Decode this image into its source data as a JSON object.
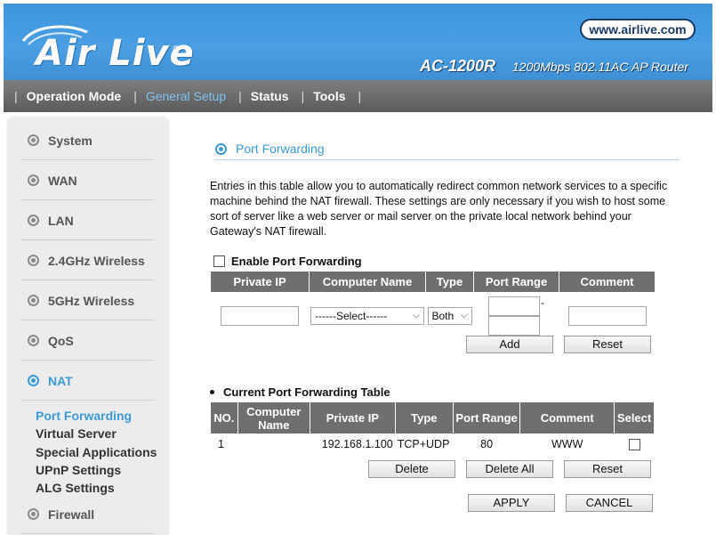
{
  "header": {
    "logo_text": "Air Live",
    "logo_reg": "®",
    "site_url": "www.airlive.com",
    "model": "AC-1200R",
    "model_desc": "1200Mbps 802.11AC AP Router"
  },
  "nav": {
    "items": [
      {
        "label": "Operation Mode"
      },
      {
        "label": "General Setup"
      },
      {
        "label": "Status"
      },
      {
        "label": "Tools"
      }
    ],
    "separator": "|"
  },
  "sidebar": {
    "items": [
      {
        "label": "System"
      },
      {
        "label": "WAN"
      },
      {
        "label": "LAN"
      },
      {
        "label": "2.4GHz Wireless"
      },
      {
        "label": "5GHz Wireless"
      },
      {
        "label": "QoS"
      },
      {
        "label": "NAT"
      },
      {
        "label": "Firewall"
      }
    ],
    "sub_items": [
      {
        "label": "Port Forwarding"
      },
      {
        "label": "Virtual Server"
      },
      {
        "label": "Special Applications"
      },
      {
        "label": "UPnP Settings"
      },
      {
        "label": "ALG Settings"
      }
    ]
  },
  "page": {
    "title": "Port Forwarding",
    "description": "Entries in this table allow you to automatically redirect common network services to a specific machine behind the NAT firewall. These settings are only necessary if you wish to host some sort of server like a web server or mail server on the private local network behind your Gateway's NAT firewall.",
    "enable_label": "Enable Port Forwarding",
    "enable_checked": false
  },
  "add_form": {
    "headers": [
      "Private IP",
      "Computer Name",
      "Type",
      "Port Range",
      "Comment"
    ],
    "private_ip": "",
    "computer_name_selected": "------Select------",
    "type_selected": "Both",
    "port_from": "",
    "port_separator": "-",
    "port_to": "",
    "comment": "",
    "add_label": "Add",
    "reset_label": "Reset"
  },
  "current_table": {
    "title": "Current Port Forwarding Table",
    "headers": [
      "NO.",
      "Computer Name",
      "Private IP",
      "Type",
      "Port Range",
      "Comment",
      "Select"
    ],
    "rows": [
      {
        "no": "1",
        "computer_name": "",
        "private_ip": "192.168.1.100",
        "type": "TCP+UDP",
        "port_range": "80",
        "comment": "WWW",
        "selected": false
      }
    ],
    "delete_label": "Delete",
    "delete_all_label": "Delete All",
    "reset_label": "Reset"
  },
  "footer_buttons": {
    "apply_label": "APPLY",
    "cancel_label": "CANCEL"
  },
  "colors": {
    "header_blue": "#4a9fe3",
    "accent_blue": "#3c9ad8",
    "nav_gray": "#5b5b5b",
    "table_header_gray": "#6f6f6f"
  }
}
